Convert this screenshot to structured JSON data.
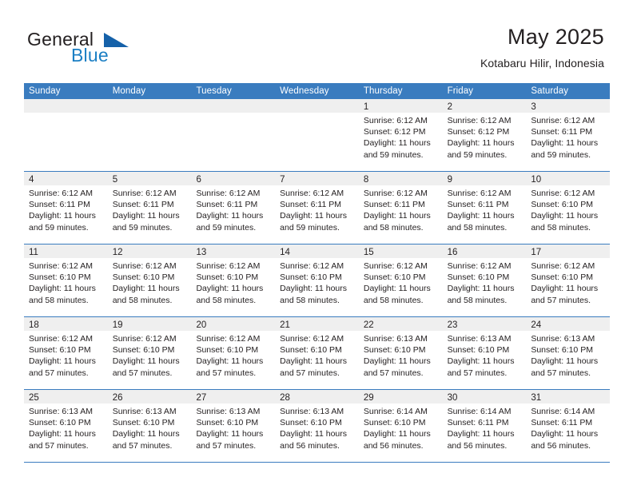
{
  "brand": {
    "line1": "General",
    "line2": "Blue",
    "triangle_icon": "triangle-icon",
    "accent_color": "#1b7fc4",
    "triangle_color": "#1561a9"
  },
  "header": {
    "month_title": "May 2025",
    "location": "Kotabaru Hilir, Indonesia"
  },
  "calendar": {
    "header_color": "#3a7cbf",
    "weekdays": [
      "Sunday",
      "Monday",
      "Tuesday",
      "Wednesday",
      "Thursday",
      "Friday",
      "Saturday"
    ],
    "weeks": [
      [
        {
          "day": "",
          "lines": []
        },
        {
          "day": "",
          "lines": []
        },
        {
          "day": "",
          "lines": []
        },
        {
          "day": "",
          "lines": []
        },
        {
          "day": "1",
          "lines": [
            "Sunrise: 6:12 AM",
            "Sunset: 6:12 PM",
            "Daylight: 11 hours",
            "and 59 minutes."
          ]
        },
        {
          "day": "2",
          "lines": [
            "Sunrise: 6:12 AM",
            "Sunset: 6:12 PM",
            "Daylight: 11 hours",
            "and 59 minutes."
          ]
        },
        {
          "day": "3",
          "lines": [
            "Sunrise: 6:12 AM",
            "Sunset: 6:11 PM",
            "Daylight: 11 hours",
            "and 59 minutes."
          ]
        }
      ],
      [
        {
          "day": "4",
          "lines": [
            "Sunrise: 6:12 AM",
            "Sunset: 6:11 PM",
            "Daylight: 11 hours",
            "and 59 minutes."
          ]
        },
        {
          "day": "5",
          "lines": [
            "Sunrise: 6:12 AM",
            "Sunset: 6:11 PM",
            "Daylight: 11 hours",
            "and 59 minutes."
          ]
        },
        {
          "day": "6",
          "lines": [
            "Sunrise: 6:12 AM",
            "Sunset: 6:11 PM",
            "Daylight: 11 hours",
            "and 59 minutes."
          ]
        },
        {
          "day": "7",
          "lines": [
            "Sunrise: 6:12 AM",
            "Sunset: 6:11 PM",
            "Daylight: 11 hours",
            "and 59 minutes."
          ]
        },
        {
          "day": "8",
          "lines": [
            "Sunrise: 6:12 AM",
            "Sunset: 6:11 PM",
            "Daylight: 11 hours",
            "and 58 minutes."
          ]
        },
        {
          "day": "9",
          "lines": [
            "Sunrise: 6:12 AM",
            "Sunset: 6:11 PM",
            "Daylight: 11 hours",
            "and 58 minutes."
          ]
        },
        {
          "day": "10",
          "lines": [
            "Sunrise: 6:12 AM",
            "Sunset: 6:10 PM",
            "Daylight: 11 hours",
            "and 58 minutes."
          ]
        }
      ],
      [
        {
          "day": "11",
          "lines": [
            "Sunrise: 6:12 AM",
            "Sunset: 6:10 PM",
            "Daylight: 11 hours",
            "and 58 minutes."
          ]
        },
        {
          "day": "12",
          "lines": [
            "Sunrise: 6:12 AM",
            "Sunset: 6:10 PM",
            "Daylight: 11 hours",
            "and 58 minutes."
          ]
        },
        {
          "day": "13",
          "lines": [
            "Sunrise: 6:12 AM",
            "Sunset: 6:10 PM",
            "Daylight: 11 hours",
            "and 58 minutes."
          ]
        },
        {
          "day": "14",
          "lines": [
            "Sunrise: 6:12 AM",
            "Sunset: 6:10 PM",
            "Daylight: 11 hours",
            "and 58 minutes."
          ]
        },
        {
          "day": "15",
          "lines": [
            "Sunrise: 6:12 AM",
            "Sunset: 6:10 PM",
            "Daylight: 11 hours",
            "and 58 minutes."
          ]
        },
        {
          "day": "16",
          "lines": [
            "Sunrise: 6:12 AM",
            "Sunset: 6:10 PM",
            "Daylight: 11 hours",
            "and 58 minutes."
          ]
        },
        {
          "day": "17",
          "lines": [
            "Sunrise: 6:12 AM",
            "Sunset: 6:10 PM",
            "Daylight: 11 hours",
            "and 57 minutes."
          ]
        }
      ],
      [
        {
          "day": "18",
          "lines": [
            "Sunrise: 6:12 AM",
            "Sunset: 6:10 PM",
            "Daylight: 11 hours",
            "and 57 minutes."
          ]
        },
        {
          "day": "19",
          "lines": [
            "Sunrise: 6:12 AM",
            "Sunset: 6:10 PM",
            "Daylight: 11 hours",
            "and 57 minutes."
          ]
        },
        {
          "day": "20",
          "lines": [
            "Sunrise: 6:12 AM",
            "Sunset: 6:10 PM",
            "Daylight: 11 hours",
            "and 57 minutes."
          ]
        },
        {
          "day": "21",
          "lines": [
            "Sunrise: 6:12 AM",
            "Sunset: 6:10 PM",
            "Daylight: 11 hours",
            "and 57 minutes."
          ]
        },
        {
          "day": "22",
          "lines": [
            "Sunrise: 6:13 AM",
            "Sunset: 6:10 PM",
            "Daylight: 11 hours",
            "and 57 minutes."
          ]
        },
        {
          "day": "23",
          "lines": [
            "Sunrise: 6:13 AM",
            "Sunset: 6:10 PM",
            "Daylight: 11 hours",
            "and 57 minutes."
          ]
        },
        {
          "day": "24",
          "lines": [
            "Sunrise: 6:13 AM",
            "Sunset: 6:10 PM",
            "Daylight: 11 hours",
            "and 57 minutes."
          ]
        }
      ],
      [
        {
          "day": "25",
          "lines": [
            "Sunrise: 6:13 AM",
            "Sunset: 6:10 PM",
            "Daylight: 11 hours",
            "and 57 minutes."
          ]
        },
        {
          "day": "26",
          "lines": [
            "Sunrise: 6:13 AM",
            "Sunset: 6:10 PM",
            "Daylight: 11 hours",
            "and 57 minutes."
          ]
        },
        {
          "day": "27",
          "lines": [
            "Sunrise: 6:13 AM",
            "Sunset: 6:10 PM",
            "Daylight: 11 hours",
            "and 57 minutes."
          ]
        },
        {
          "day": "28",
          "lines": [
            "Sunrise: 6:13 AM",
            "Sunset: 6:10 PM",
            "Daylight: 11 hours",
            "and 56 minutes."
          ]
        },
        {
          "day": "29",
          "lines": [
            "Sunrise: 6:14 AM",
            "Sunset: 6:10 PM",
            "Daylight: 11 hours",
            "and 56 minutes."
          ]
        },
        {
          "day": "30",
          "lines": [
            "Sunrise: 6:14 AM",
            "Sunset: 6:11 PM",
            "Daylight: 11 hours",
            "and 56 minutes."
          ]
        },
        {
          "day": "31",
          "lines": [
            "Sunrise: 6:14 AM",
            "Sunset: 6:11 PM",
            "Daylight: 11 hours",
            "and 56 minutes."
          ]
        }
      ]
    ]
  }
}
